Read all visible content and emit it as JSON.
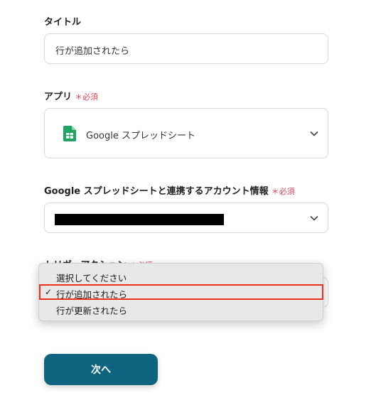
{
  "title_field": {
    "label": "タイトル",
    "value": "行が追加されたら"
  },
  "app_field": {
    "label": "アプリ",
    "required": "＊必須",
    "value": "Google スプレッドシート",
    "icon": "google-sheets-icon"
  },
  "account_field": {
    "label": "Google スプレッドシートと連携するアカウント情報",
    "required": "＊必須",
    "value_redacted": true
  },
  "trigger_field": {
    "label": "トリガーアクション",
    "required": "＊必須",
    "options": [
      {
        "label": "選択してください",
        "selected": false
      },
      {
        "label": "行が追加されたら",
        "selected": true
      },
      {
        "label": "行が更新されたら",
        "selected": false
      }
    ],
    "check_mark": "✓"
  },
  "next_button": {
    "label": "次へ"
  },
  "colors": {
    "primary_button": "#0f6480",
    "required_red": "#e0455a",
    "highlight_border": "#e8321e",
    "sheets_green": "#1fa463"
  }
}
